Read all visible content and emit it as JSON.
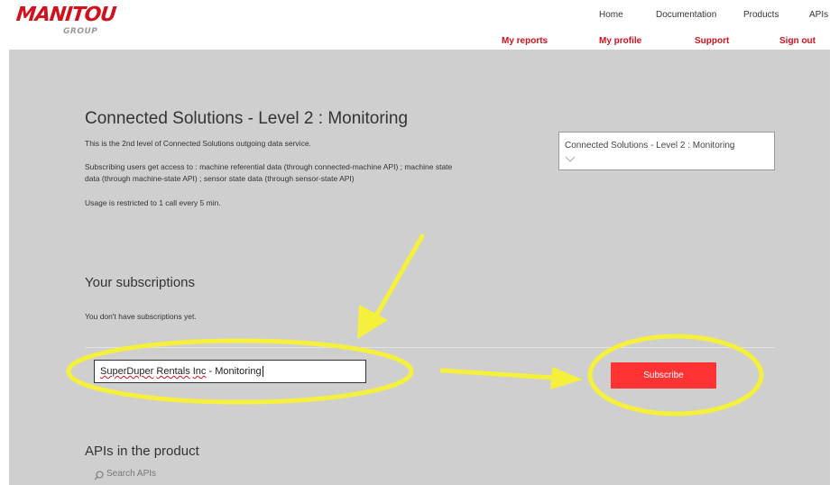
{
  "brand": {
    "name": "MANITOU",
    "sub": "GROUP",
    "color": "#d1111c"
  },
  "top_nav": [
    "Home",
    "Documentation",
    "Products",
    "APIs"
  ],
  "sub_nav": [
    "My reports",
    "My profile",
    "Support",
    "Sign out"
  ],
  "product": {
    "title": "Connected Solutions - Level 2 : Monitoring",
    "desc1": "This is the 2nd level of Connected Solutions outgoing data service.",
    "desc2a": "Subscribing users get access to : machine referential data (through connected-machine API) ; machine state",
    "desc2b": "data (through machine-state API) ; sensor state data (through sensor-state API)",
    "desc3": "Usage is restricted to 1 call every 5 min.",
    "selected_product": "Connected Solutions - Level 2 : Monitoring"
  },
  "subscriptions": {
    "heading": "Your subscriptions",
    "empty_text": "You don't have subscriptions yet.",
    "name_word1": "SuperDuper",
    "name_word2": "Rentals",
    "name_word3": "Inc",
    "name_rest": " - Monitoring",
    "subscribe_label": "Subscribe"
  },
  "apis": {
    "heading": "APIs in the product",
    "search_placeholder": "Search APIs"
  },
  "colors": {
    "accent": "#d1111c",
    "button": "#ff3333",
    "annotation": "#f4f03c",
    "panel": "#cfcfcf"
  }
}
